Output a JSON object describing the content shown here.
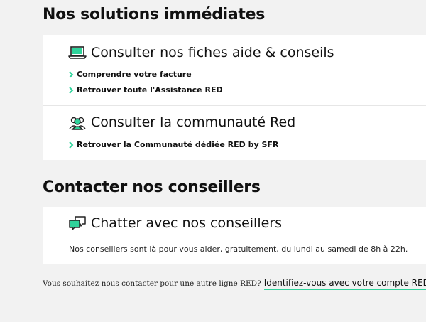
{
  "sections": {
    "solutions": {
      "heading": "Nos solutions immédiates",
      "fiches": {
        "icon": "laptop-icon",
        "title": "Consulter nos fiches aide & conseils",
        "links": [
          "Comprendre votre facture",
          "Retrouver toute l'Assistance RED"
        ]
      },
      "communaute": {
        "icon": "community-icon",
        "title": "Consulter la communauté Red",
        "links": [
          "Retrouver la Communauté dédiée RED by SFR"
        ]
      }
    },
    "contact": {
      "heading": "Contacter nos conseillers",
      "chat": {
        "icon": "chat-bubbles-icon",
        "title": "Chatter avec nos conseillers",
        "description": "Nos conseillers sont là pour vous aider, gratuitement, du lundi au samedi de 8h à 22h."
      }
    }
  },
  "footer": {
    "text": "Vous souhaitez nous contacter pour une autre ligne RED?",
    "link": "Identifiez-vous avec votre compte RED"
  },
  "colors": {
    "accent": "#2fd39b",
    "background": "#f2f2f2",
    "card": "#ffffff"
  }
}
